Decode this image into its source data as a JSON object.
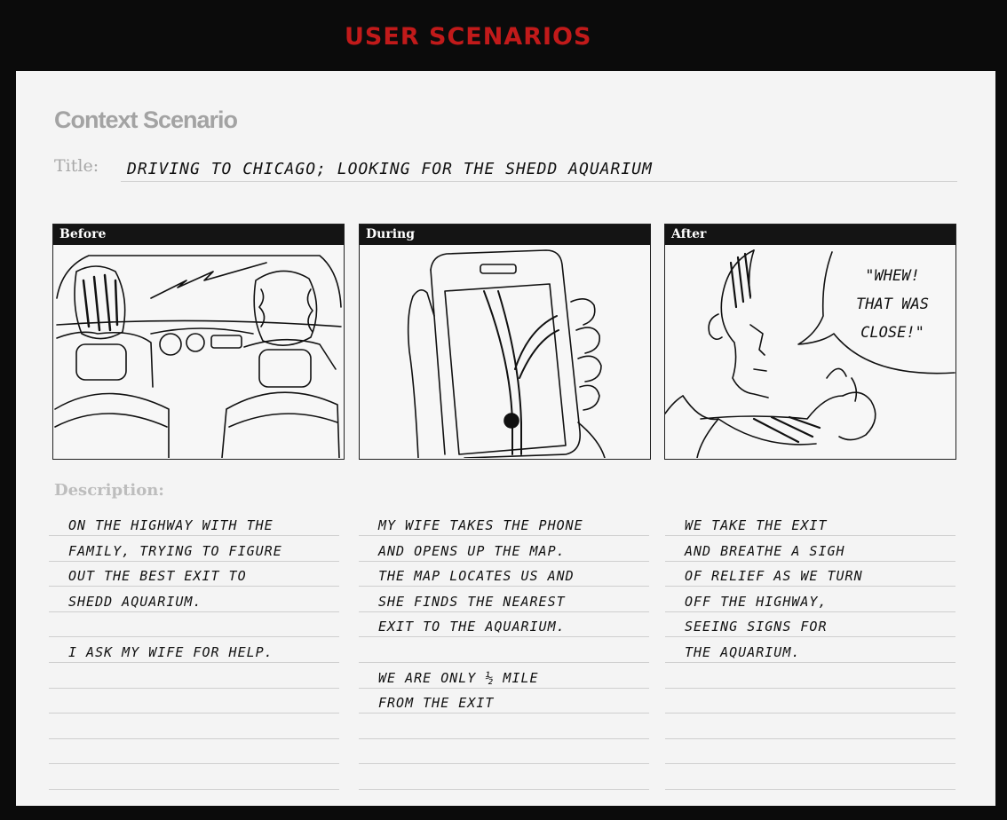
{
  "slide_title": "USER SCENARIOS",
  "form": {
    "heading": "Context Scenario",
    "title_label": "Title:",
    "title_value": "DRIVING TO CHICAGO; LOOKING FOR THE SHEDD AQUARIUM",
    "description_label": "Description:"
  },
  "panels": [
    {
      "label": "Before"
    },
    {
      "label": "During"
    },
    {
      "label": "After",
      "speech": [
        "\"WHEW!",
        "THAT WAS",
        "CLOSE!\""
      ]
    }
  ],
  "descriptions": [
    {
      "lines": [
        "ON THE HIGHWAY WITH THE",
        "FAMILY, TRYING TO FIGURE",
        "OUT THE BEST EXIT TO",
        "SHEDD AQUARIUM.",
        "",
        "I ASK MY WIFE FOR HELP."
      ]
    },
    {
      "lines": [
        "MY WIFE TAKES THE PHONE",
        "AND OPENS UP THE MAP.",
        "THE MAP LOCATES US AND",
        "SHE FINDS THE NEAREST",
        "EXIT TO THE AQUARIUM.",
        "",
        "WE ARE ONLY ½ MILE",
        "FROM THE EXIT"
      ]
    },
    {
      "lines": [
        "WE TAKE THE EXIT",
        "AND BREATHE A SIGH",
        "OF RELIEF AS WE TURN",
        "OFF THE HIGHWAY,",
        "SEEING SIGNS FOR",
        "THE AQUARIUM."
      ]
    }
  ]
}
